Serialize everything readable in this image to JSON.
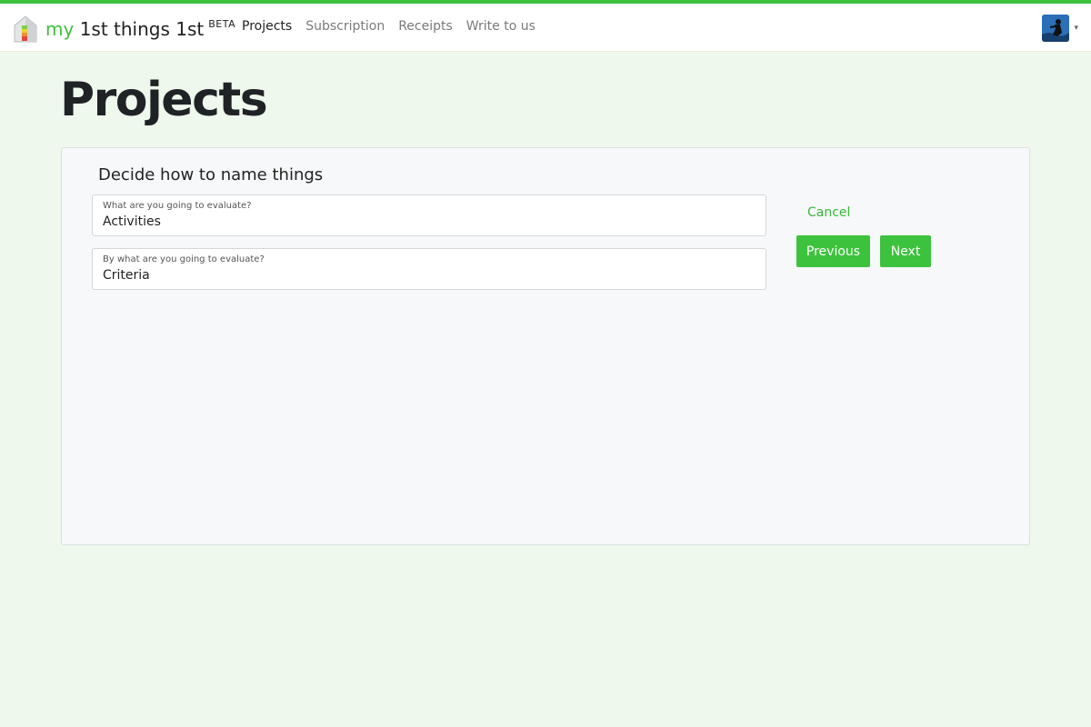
{
  "app": {
    "brand_prefix": "my",
    "brand_name": "1st things 1st",
    "brand_badge": "BETA"
  },
  "nav": {
    "items": [
      {
        "label": "Projects",
        "active": true
      },
      {
        "label": "Subscription",
        "active": false
      },
      {
        "label": "Receipts",
        "active": false
      },
      {
        "label": "Write to us",
        "active": false
      }
    ]
  },
  "user_menu": {
    "caret": "▾"
  },
  "page": {
    "title": "Projects"
  },
  "wizard": {
    "heading": "Decide how to name things",
    "fields": [
      {
        "label": "What are you going to evaluate?",
        "value": "Activities"
      },
      {
        "label": "By what are you going to evaluate?",
        "value": "Criteria"
      }
    ],
    "cancel_label": "Cancel",
    "previous_label": "Previous",
    "next_label": "Next"
  },
  "colors": {
    "accent": "#3cc23c",
    "background": "#eef8ec",
    "card": "#f6f8f9"
  }
}
